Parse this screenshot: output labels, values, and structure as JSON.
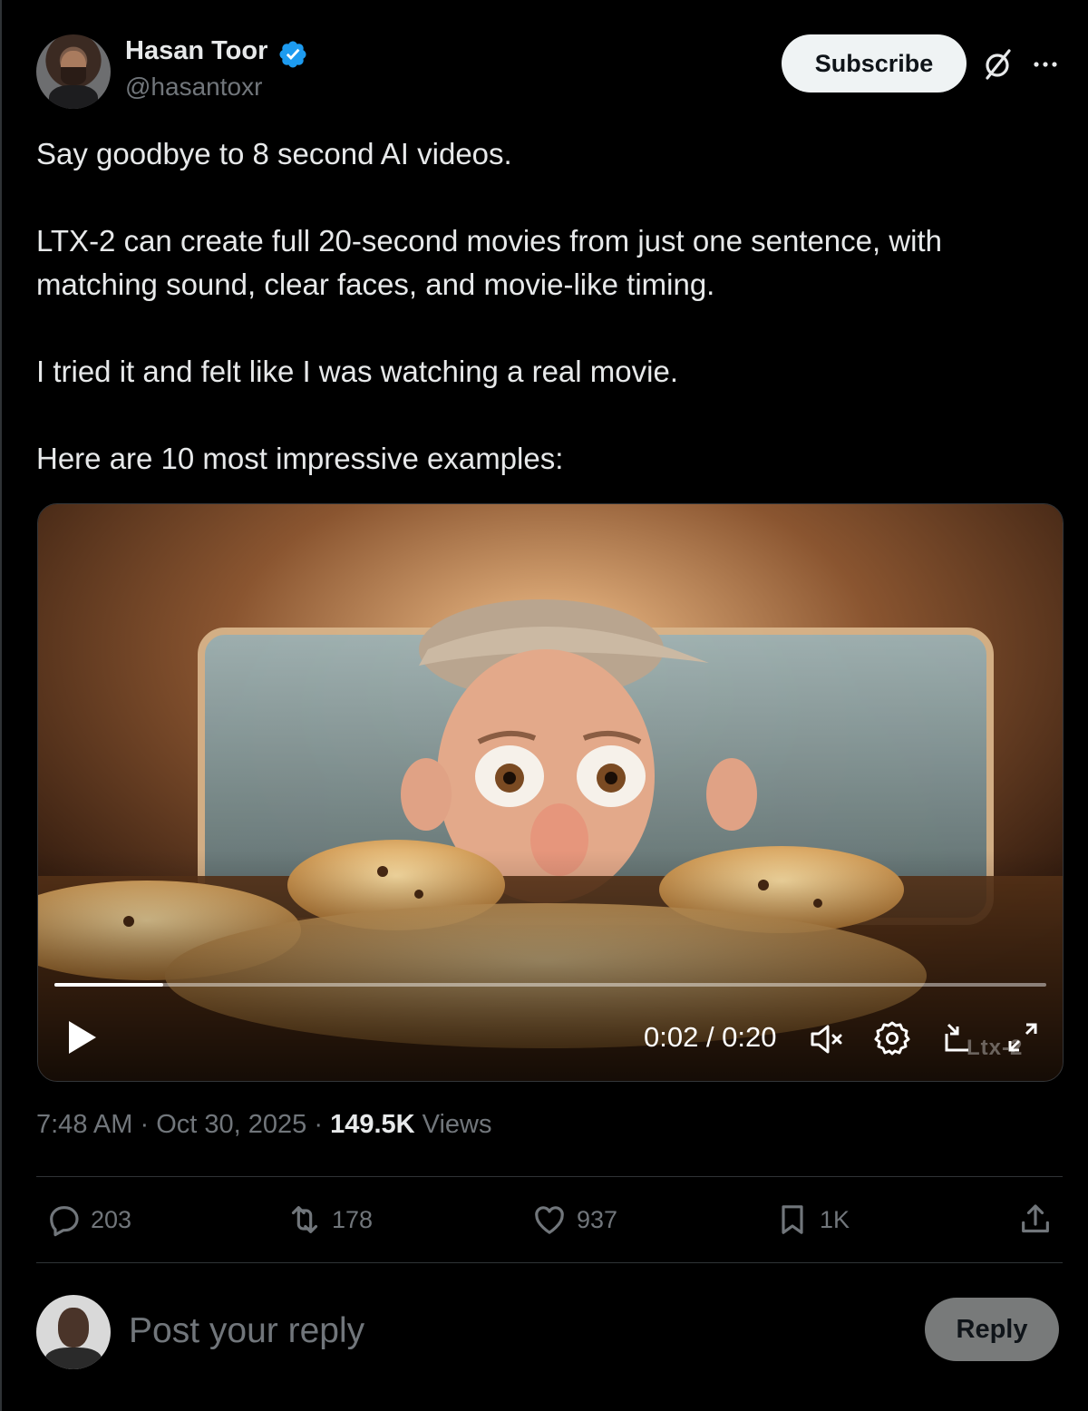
{
  "author": {
    "display_name": "Hasan Toor",
    "handle": "@hasantoxr",
    "verified": true,
    "verified_color": "#1d9bf0"
  },
  "header": {
    "subscribe_label": "Subscribe",
    "icons": [
      "grok-icon",
      "more-icon"
    ]
  },
  "post": {
    "paragraphs": [
      "Say goodbye to 8 second AI videos.",
      "LTX-2 can create full 20-second movies from just one sentence, with matching sound, clear faces, and movie-like timing.",
      "I tried it and felt like I was watching a real movie.",
      "Here are 10 most impressive examples:"
    ]
  },
  "video": {
    "time_display": "0:02 / 0:20",
    "progress_fraction": 0.11,
    "watermark": "Ltx-2",
    "controls": [
      "play-icon",
      "mute-icon",
      "gear-icon",
      "pip-icon",
      "fullscreen-icon"
    ]
  },
  "meta": {
    "time": "7:48 AM",
    "date": "Oct 30, 2025",
    "separator": "·",
    "views_count": "149.5K",
    "views_label": "Views"
  },
  "actions": {
    "replies": "203",
    "reposts": "178",
    "likes": "937",
    "bookmarks": "1K"
  },
  "reply_bar": {
    "placeholder": "Post your reply",
    "button_label": "Reply"
  },
  "colors": {
    "background": "#000000",
    "text": "#e7e9ea",
    "muted": "#71767b",
    "accent": "#1d9bf0"
  }
}
